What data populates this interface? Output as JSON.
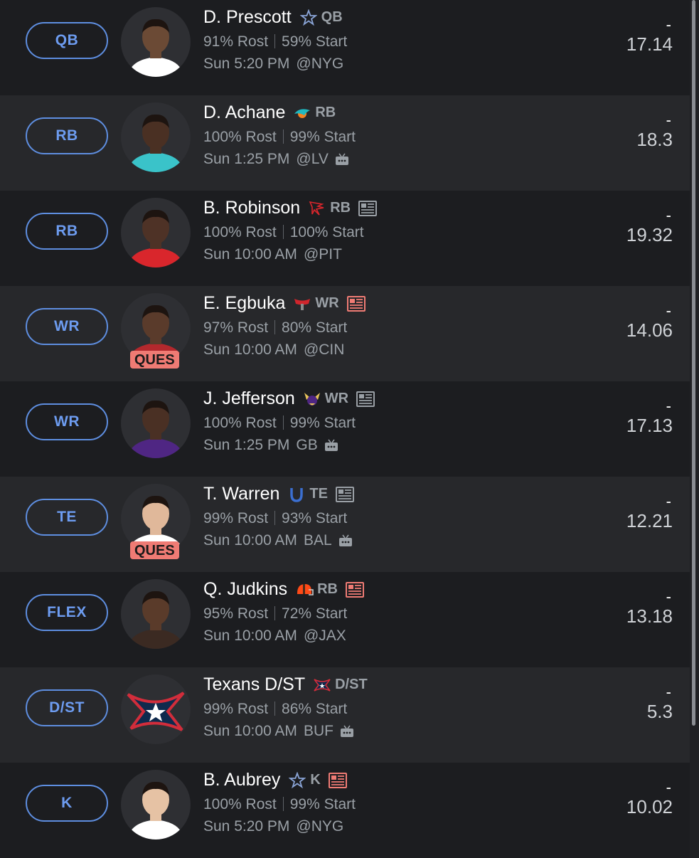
{
  "players": [
    {
      "slot": "QB",
      "name": "D. Prescott",
      "team_icon": "cowboys-star-icon",
      "position": "QB",
      "news": "none",
      "rostered": "91% Rost",
      "started": "59% Start",
      "day_time": "Sun 5:20 PM",
      "opponent": "@NYG",
      "tv": false,
      "status": "",
      "dash": "-",
      "projection": "17.14",
      "jersey": "#ffffff",
      "skin": "#6b4a35"
    },
    {
      "slot": "RB",
      "name": "D. Achane",
      "team_icon": "dolphins-icon",
      "position": "RB",
      "news": "none",
      "rostered": "100% Rost",
      "started": "99% Start",
      "day_time": "Sun 1:25 PM",
      "opponent": "@LV",
      "tv": true,
      "status": "",
      "dash": "-",
      "projection": "18.3",
      "jersey": "#3ac3c9",
      "skin": "#4a3023"
    },
    {
      "slot": "RB",
      "name": "B. Robinson",
      "team_icon": "falcons-icon",
      "position": "RB",
      "news": "gray",
      "rostered": "100% Rost",
      "started": "100% Start",
      "day_time": "Sun 10:00 AM",
      "opponent": "@PIT",
      "tv": false,
      "status": "",
      "dash": "-",
      "projection": "19.32",
      "jersey": "#d9262c",
      "skin": "#4e3226"
    },
    {
      "slot": "WR",
      "name": "E. Egbuka",
      "team_icon": "buccaneers-icon",
      "position": "WR",
      "news": "red",
      "rostered": "97% Rost",
      "started": "80% Start",
      "day_time": "Sun 10:00 AM",
      "opponent": "@CIN",
      "tv": false,
      "status": "QUES",
      "dash": "-",
      "projection": "14.06",
      "jersey": "#b3282d",
      "skin": "#5a3b2b"
    },
    {
      "slot": "WR",
      "name": "J. Jefferson",
      "team_icon": "vikings-icon",
      "position": "WR",
      "news": "gray",
      "rostered": "100% Rost",
      "started": "99% Start",
      "day_time": "Sun 1:25 PM",
      "opponent": "GB",
      "tv": true,
      "status": "",
      "dash": "-",
      "projection": "17.13",
      "jersey": "#4f2683",
      "skin": "#4a3024"
    },
    {
      "slot": "TE",
      "name": "T. Warren",
      "team_icon": "colts-icon",
      "position": "TE",
      "news": "gray",
      "rostered": "99% Rost",
      "started": "93% Start",
      "day_time": "Sun 10:00 AM",
      "opponent": "BAL",
      "tv": true,
      "status": "QUES",
      "dash": "-",
      "projection": "12.21",
      "jersey": "#ffffff",
      "skin": "#e0b89a"
    },
    {
      "slot": "FLEX",
      "name": "Q. Judkins",
      "team_icon": "browns-icon",
      "position": "RB",
      "news": "red",
      "rostered": "95% Rost",
      "started": "72% Start",
      "day_time": "Sun 10:00 AM",
      "opponent": "@JAX",
      "tv": false,
      "status": "",
      "dash": "-",
      "projection": "13.18",
      "jersey": "#3b2a22",
      "skin": "#5a3b2a"
    },
    {
      "slot": "D/ST",
      "name": "Texans D/ST",
      "team_icon": "texans-icon",
      "position": "D/ST",
      "news": "none",
      "rostered": "99% Rost",
      "started": "86% Start",
      "day_time": "Sun 10:00 AM",
      "opponent": "BUF",
      "tv": true,
      "status": "",
      "dash": "-",
      "projection": "5.3",
      "jersey": "",
      "skin": ""
    },
    {
      "slot": "K",
      "name": "B. Aubrey",
      "team_icon": "cowboys-star-icon",
      "position": "K",
      "news": "red",
      "rostered": "100% Rost",
      "started": "99% Start",
      "day_time": "Sun 5:20 PM",
      "opponent": "@NYG",
      "tv": false,
      "status": "",
      "dash": "-",
      "projection": "10.02",
      "jersey": "#ffffff",
      "skin": "#e6c2a4"
    }
  ]
}
